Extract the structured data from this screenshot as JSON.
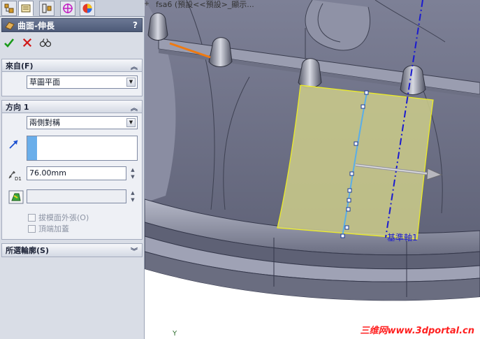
{
  "viewport": {
    "title": "fsa6 (預設<<預設>_顯示...",
    "ref_axis_label": "基準軸1",
    "axis_label": "Y",
    "watermark": "三维网www.3dportal.cn"
  },
  "tabs": [
    {
      "icon": "feature-manager-icon"
    },
    {
      "icon": "property-manager-icon"
    },
    {
      "icon": "configuration-manager-icon"
    },
    {
      "icon": "dimxpert-icon"
    },
    {
      "icon": "display-manager-icon"
    }
  ],
  "property_manager": {
    "title": "曲面-伸長",
    "help": "?",
    "actions": {
      "ok": "ok-icon",
      "cancel": "cancel-icon",
      "preview": "detailed-preview-icon"
    },
    "from_group": {
      "header": "來自(F)",
      "selected": "草圖平面"
    },
    "direction1_group": {
      "header": "方向 1",
      "end_condition": "兩側對稱",
      "depth_value": "76.00mm",
      "draft_label": "拔模面外張(O)",
      "cap_label": "頂端加蓋"
    },
    "selected_contours_group": {
      "header": "所選輪廓(S)"
    }
  }
}
